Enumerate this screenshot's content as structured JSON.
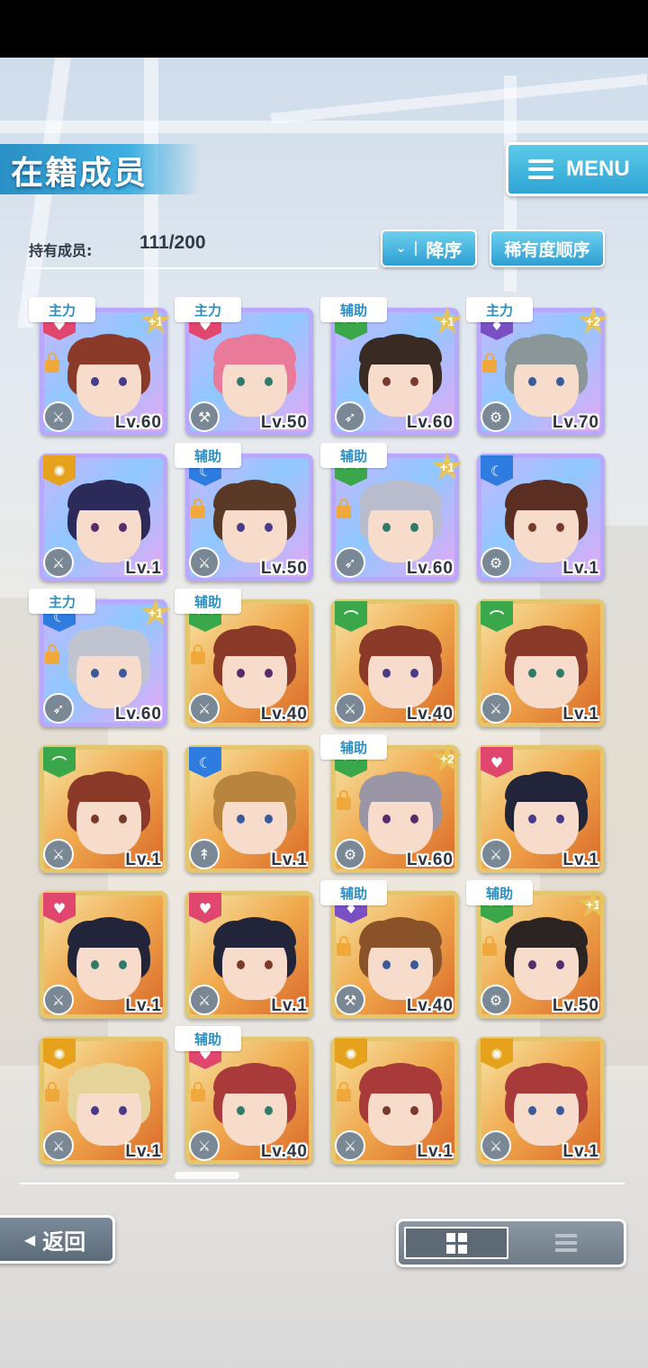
{
  "header": {
    "title": "在籍成员",
    "menu_label": "MENU"
  },
  "roster": {
    "count_label": "持有成员:",
    "count_value": "111/200"
  },
  "sort": {
    "order_label": "降序",
    "rarity_label": "稀有度顺序"
  },
  "members": [
    {
      "tag": "主力",
      "plus": "+1",
      "level": "Lv.60",
      "attr": "pink",
      "rarity": "rare",
      "hair": "#8b3a2a",
      "locked": true,
      "weapon": "sword"
    },
    {
      "tag": "主力",
      "plus": "",
      "level": "Lv.50",
      "attr": "pink",
      "rarity": "rare",
      "hair": "#ea7a9a",
      "locked": false,
      "weapon": "axe"
    },
    {
      "tag": "辅助",
      "plus": "+1",
      "level": "Lv.60",
      "attr": "green",
      "rarity": "rare",
      "hair": "#3a2a24",
      "locked": false,
      "weapon": "bow"
    },
    {
      "tag": "主力",
      "plus": "+2",
      "level": "Lv.70",
      "attr": "purple",
      "rarity": "rare",
      "hair": "#8a9698",
      "locked": true,
      "weapon": "gear"
    },
    {
      "tag": "",
      "plus": "",
      "level": "Lv.1",
      "attr": "yellow",
      "rarity": "rare",
      "hair": "#2c2a58",
      "locked": false,
      "weapon": "sword"
    },
    {
      "tag": "辅助",
      "plus": "",
      "level": "Lv.50",
      "attr": "blue",
      "rarity": "rare",
      "hair": "#5a3a26",
      "locked": true,
      "weapon": "sword"
    },
    {
      "tag": "辅助",
      "plus": "+1",
      "level": "Lv.60",
      "attr": "green",
      "rarity": "rare",
      "hair": "#b8bccd",
      "locked": true,
      "weapon": "bow"
    },
    {
      "tag": "",
      "plus": "",
      "level": "Lv.1",
      "attr": "blue",
      "rarity": "rare",
      "hair": "#5a2e22",
      "locked": false,
      "weapon": "gear"
    },
    {
      "tag": "主力",
      "plus": "+1",
      "level": "Lv.60",
      "attr": "blue",
      "rarity": "rare",
      "hair": "#c0c4d0",
      "locked": true,
      "weapon": "bow"
    },
    {
      "tag": "辅助",
      "plus": "",
      "level": "Lv.40",
      "attr": "green",
      "rarity": "gold",
      "hair": "#8b3a2a",
      "locked": true,
      "weapon": "sword"
    },
    {
      "tag": "",
      "plus": "",
      "level": "Lv.40",
      "attr": "green",
      "rarity": "gold",
      "hair": "#8b3a2a",
      "locked": false,
      "weapon": "sword"
    },
    {
      "tag": "",
      "plus": "",
      "level": "Lv.1",
      "attr": "green",
      "rarity": "gold",
      "hair": "#8b3a2a",
      "locked": false,
      "weapon": "sword"
    },
    {
      "tag": "",
      "plus": "",
      "level": "Lv.1",
      "attr": "green",
      "rarity": "gold",
      "hair": "#8b3a2a",
      "locked": false,
      "weapon": "sword"
    },
    {
      "tag": "",
      "plus": "",
      "level": "Lv.1",
      "attr": "blue",
      "rarity": "gold",
      "hair": "#b9843e",
      "locked": false,
      "weapon": "spear"
    },
    {
      "tag": "辅助",
      "plus": "+2",
      "level": "Lv.60",
      "attr": "green",
      "rarity": "gold",
      "hair": "#9a96a6",
      "locked": true,
      "weapon": "gear"
    },
    {
      "tag": "",
      "plus": "",
      "level": "Lv.1",
      "attr": "pink",
      "rarity": "gold",
      "hair": "#22243a",
      "locked": false,
      "weapon": "sword"
    },
    {
      "tag": "",
      "plus": "",
      "level": "Lv.1",
      "attr": "pink",
      "rarity": "gold",
      "hair": "#22243a",
      "locked": false,
      "weapon": "sword"
    },
    {
      "tag": "",
      "plus": "",
      "level": "Lv.1",
      "attr": "pink",
      "rarity": "gold",
      "hair": "#22243a",
      "locked": false,
      "weapon": "sword"
    },
    {
      "tag": "辅助",
      "plus": "",
      "level": "Lv.40",
      "attr": "purple",
      "rarity": "gold",
      "hair": "#8a5228",
      "locked": true,
      "weapon": "axe"
    },
    {
      "tag": "辅助",
      "plus": "+1",
      "level": "Lv.50",
      "attr": "green",
      "rarity": "gold",
      "hair": "#2c2422",
      "locked": true,
      "weapon": "gear"
    },
    {
      "tag": "",
      "plus": "",
      "level": "Lv.1",
      "attr": "yellow",
      "rarity": "gold",
      "hair": "#e4d49a",
      "locked": true,
      "weapon": "sword"
    },
    {
      "tag": "辅助",
      "plus": "",
      "level": "Lv.40",
      "attr": "pink",
      "rarity": "gold",
      "hair": "#a83a3a",
      "locked": true,
      "weapon": "sword"
    },
    {
      "tag": "",
      "plus": "",
      "level": "Lv.1",
      "attr": "yellow",
      "rarity": "gold",
      "hair": "#a83a3a",
      "locked": true,
      "weapon": "sword"
    },
    {
      "tag": "",
      "plus": "",
      "level": "Lv.1",
      "attr": "yellow",
      "rarity": "gold",
      "hair": "#a83a3a",
      "locked": false,
      "weapon": "sword"
    }
  ],
  "colors": {
    "accent": "#2ea4d4",
    "attr_pink": "#e0466e",
    "attr_green": "#3aa84a",
    "attr_blue": "#2e7ce0",
    "attr_purple": "#7a4fc4",
    "attr_yellow": "#e6a21c"
  },
  "footer": {
    "back_label": "返回"
  }
}
